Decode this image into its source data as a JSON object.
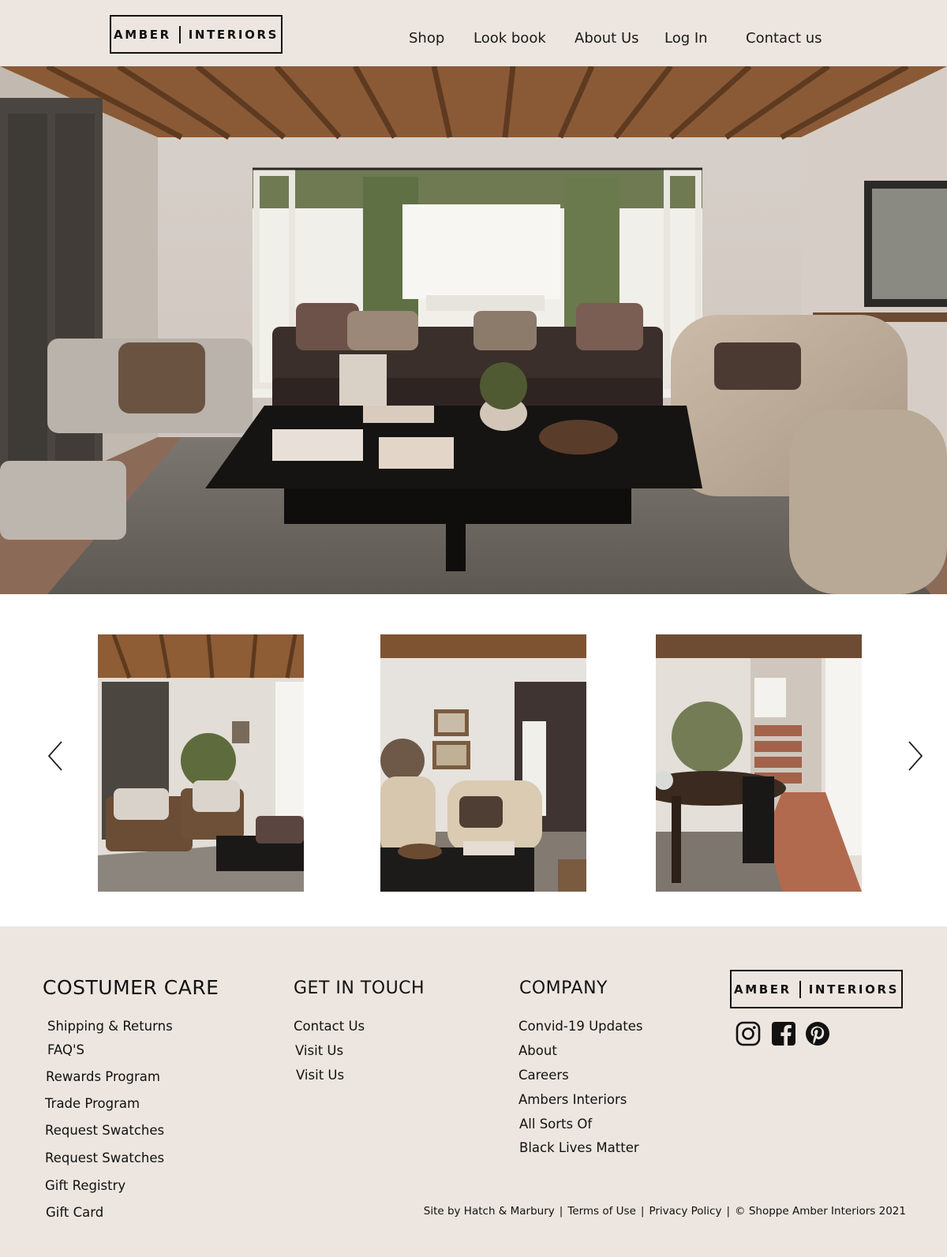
{
  "header": {
    "logo_left": "AMBER",
    "logo_right": "INTERIORS",
    "nav": [
      {
        "label": "Shop"
      },
      {
        "label": "Look book"
      },
      {
        "label": "About Us"
      },
      {
        "label": "Log In"
      },
      {
        "label": "Contact us"
      }
    ]
  },
  "footer": {
    "customer_care": {
      "title": "COSTUMER  CARE",
      "links": [
        "Shipping & Returns",
        "FAQ'S",
        "Rewards Program",
        "Trade Program",
        "Request Swatches",
        "Request Swatches",
        "Gift Registry",
        "Gift Card"
      ]
    },
    "get_in_touch": {
      "title": "GET IN TOUCH",
      "links": [
        "Contact Us",
        "Visit Us",
        "Visit Us"
      ]
    },
    "company": {
      "title": "COMPANY",
      "links": [
        "Convid-19 Updates",
        "About",
        "Careers",
        "Ambers Interiors",
        "All Sorts Of",
        "Black Lives Matter"
      ]
    },
    "logo_left": "AMBER",
    "logo_right": "INTERIORS",
    "social": [
      "instagram-icon",
      "facebook-icon",
      "pinterest-icon"
    ],
    "legal": {
      "site_by": "Site by Hatch & Marbury",
      "terms": "Terms of Use",
      "privacy": "Privacy Policy",
      "copyright": "© Shoppe Amber Interiors 2021",
      "separator": "|"
    }
  },
  "colors": {
    "header_bg": "#ede6e0",
    "footer_bg": "#ede6e0",
    "text": "#111111"
  }
}
